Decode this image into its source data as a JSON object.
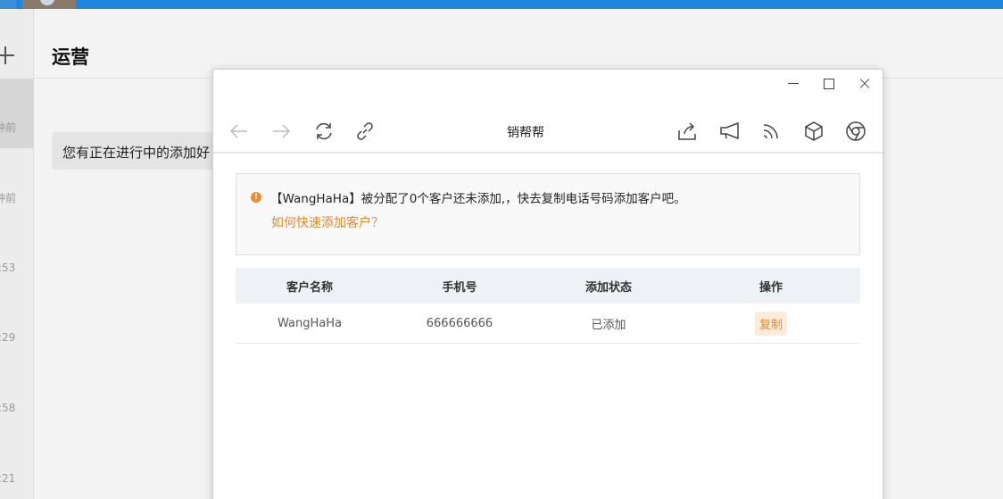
{
  "page": {
    "title": "运营",
    "notice": "您有正在进行中的添加好"
  },
  "timestamps": [
    "钟前",
    "钟前",
    ":53",
    ":29",
    ":58",
    ":21"
  ],
  "window": {
    "title": "销帮帮",
    "alert": {
      "message": "【WangHaHa】被分配了0个客户还未添加,，快去复制电话号码添加客户吧。",
      "link": "如何快速添加客户？"
    },
    "table": {
      "headers": [
        "客户名称",
        "手机号",
        "添加状态",
        "操作"
      ],
      "rows": [
        {
          "name": "WangHaHa",
          "phone": "666666666",
          "status": "已添加",
          "action": "复制"
        }
      ]
    }
  },
  "colors": {
    "accent": "#e3892a",
    "topbar": "#1f86e0",
    "alert_icon": "#f08c2e"
  },
  "icons": [
    "back-icon",
    "forward-icon",
    "refresh-icon",
    "link-icon",
    "share-icon",
    "megaphone-icon",
    "rss-icon",
    "cube-icon",
    "chrome-icon"
  ]
}
